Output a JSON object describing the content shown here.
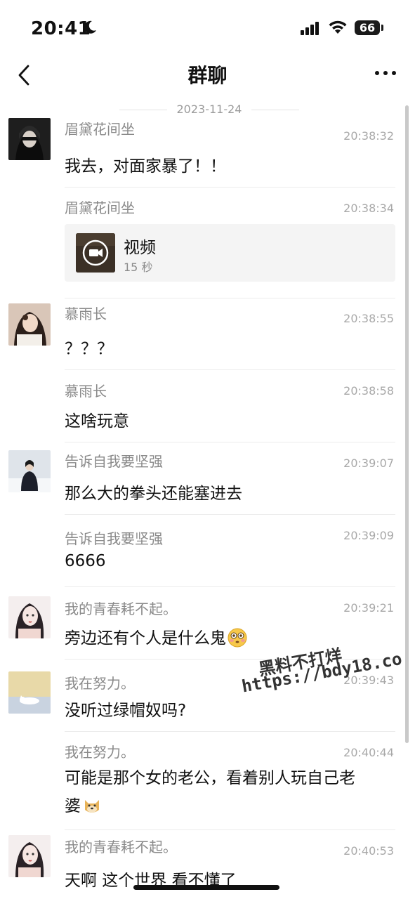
{
  "status_bar": {
    "time": "20:41",
    "battery": "66"
  },
  "nav": {
    "title": "群聊"
  },
  "date_divider": "2023-11-24",
  "messages": [
    {
      "sender": "眉黛花间坐",
      "time": "20:38:32",
      "text": "我去，对面家暴了！！",
      "avatar": "dark-hooded-avatar"
    },
    {
      "sender": "眉黛花间坐",
      "time": "20:38:34",
      "video": {
        "label": "视频",
        "duration": "15 秒"
      }
    },
    {
      "sender": "慕雨长",
      "time": "20:38:55",
      "text": "？？？",
      "avatar": "girl-selfie-avatar"
    },
    {
      "sender": "慕雨长",
      "time": "20:38:58",
      "text": "这啥玩意"
    },
    {
      "sender": "告诉自我要坚强",
      "time": "20:39:07",
      "text": "那么大的拳头还能塞进去",
      "avatar": "snow-girl-avatar"
    },
    {
      "sender": "告诉自我要坚强",
      "time": "20:39:09",
      "text": "6666"
    },
    {
      "sender": "我的青春耗不起。",
      "time": "20:39:21",
      "text": "旁边还有个人是什么鬼",
      "emoji": "flushed-face",
      "avatar": "anime-girl-avatar"
    },
    {
      "sender": "我在努力。",
      "time": "20:39:43",
      "text": "没听过绿帽奴吗?",
      "avatar": "lying-cat-avatar"
    },
    {
      "sender": "我在努力。",
      "time": "20:40:44",
      "text_line1": "可能是那个女的老公，看着别人玩自己老",
      "text_line2": "婆",
      "emoji": "doge-face"
    },
    {
      "sender": "我的青春耗不起。",
      "time": "20:40:53",
      "text": "天啊 这个世界 看不懂了",
      "avatar": "anime-girl-avatar"
    }
  ],
  "watermark": {
    "line1": "黑料不打烊",
    "line2": "https://bdy18.co"
  },
  "colors": {
    "background": "#ffffff",
    "secondary_text": "#8a8a8a",
    "divider": "#ececec"
  }
}
